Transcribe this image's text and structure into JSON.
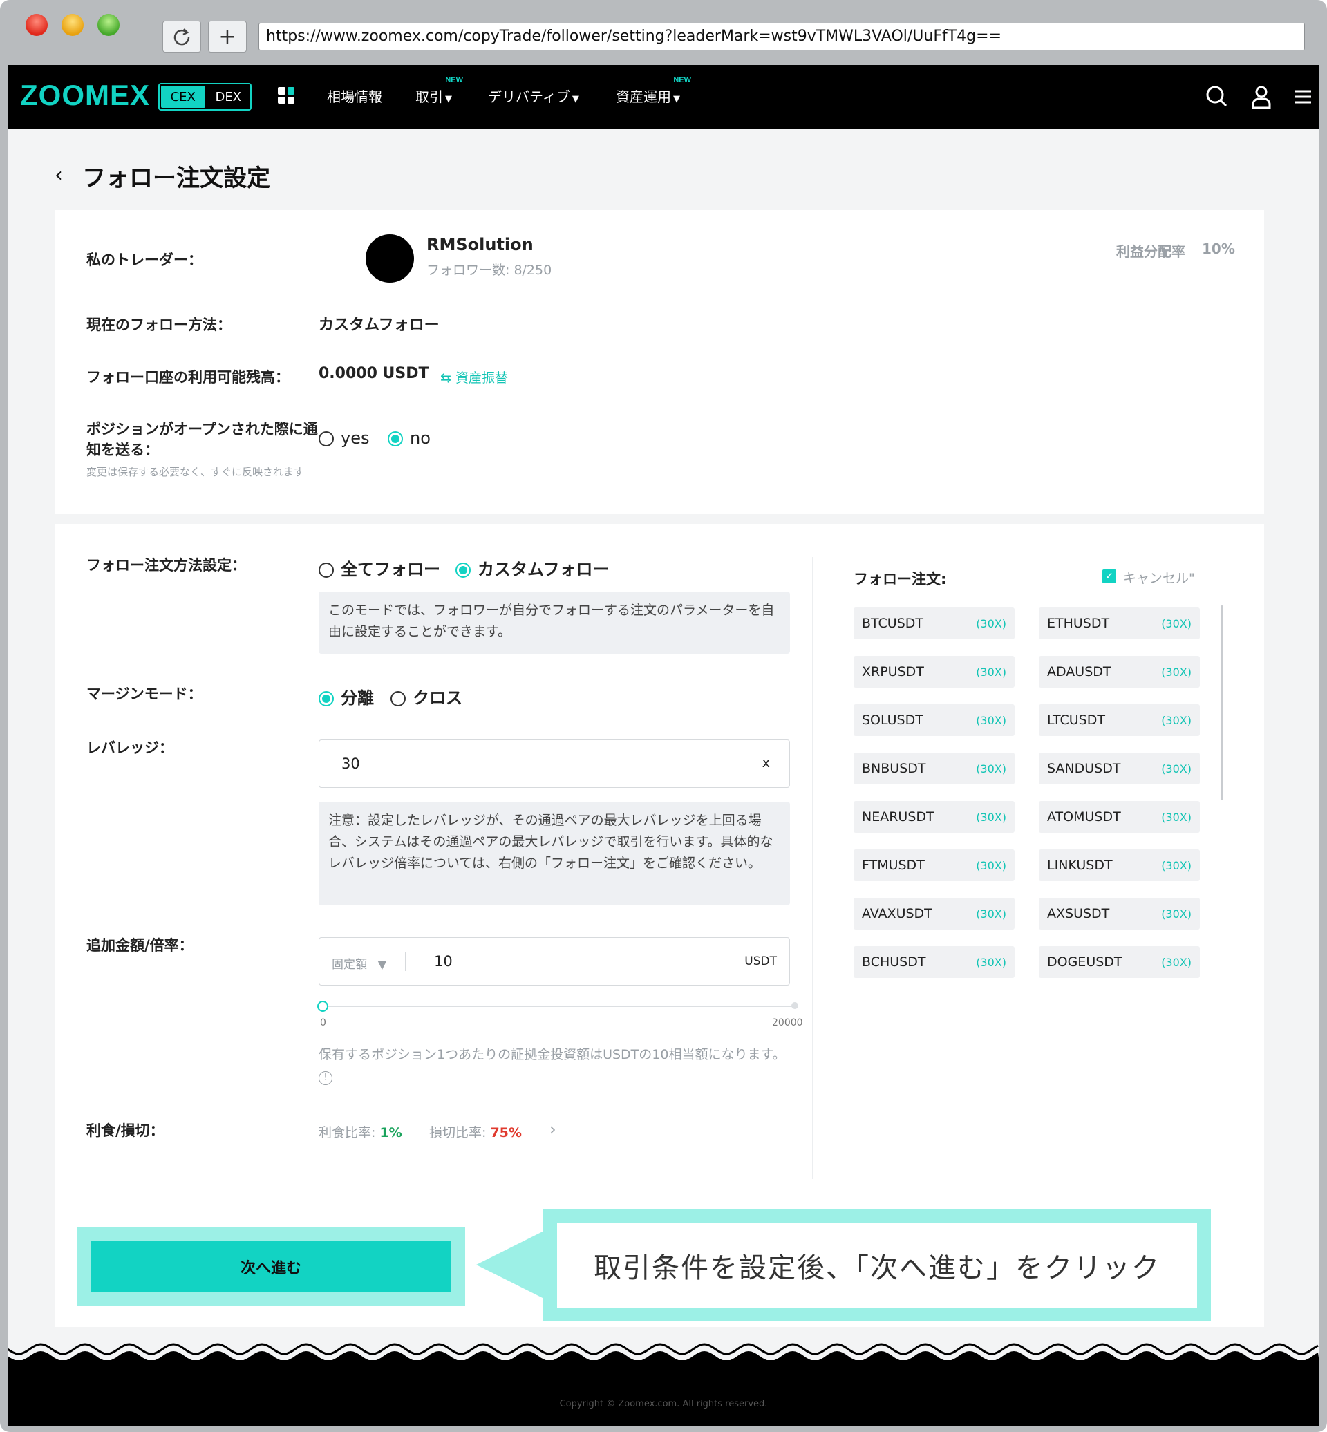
{
  "browser": {
    "url": "https://www.zoomex.com/copyTrade/follower/setting?leaderMark=wst9vTMWL3VAOl/UuFfT4g==",
    "reload_icon": "reload-icon",
    "new_tab_icon": "plus-icon"
  },
  "nav": {
    "logo": "ZOOMEX",
    "cex": "CEX",
    "dex": "DEX",
    "items": [
      {
        "label": "相場情報",
        "new": ""
      },
      {
        "label": "取引",
        "new": "NEW"
      },
      {
        "label": "デリバティブ",
        "new": ""
      },
      {
        "label": "資産運用",
        "new": "NEW"
      }
    ],
    "accent": "#12d3c3"
  },
  "page": {
    "title": "フォロー注文設定"
  },
  "trader": {
    "label": "私のトレーダー：",
    "name": "RMSolution",
    "followers": "フォロワー数: 8/250",
    "profit_share_label": "利益分配率",
    "profit_share": "10%"
  },
  "follow_method": {
    "label": "現在のフォロー方法：",
    "value": "カスタムフォロー"
  },
  "balance": {
    "label": "フォロー口座の利用可能残高：",
    "value": "0.0000 USDT",
    "transfer": "資産振替"
  },
  "notify": {
    "label": "ポジションがオープンされた際に通知を送る：",
    "hint": "変更は保存する必要なく、すぐに反映されます",
    "yes": "yes",
    "no": "no",
    "selected": "no"
  },
  "settings": {
    "method_label": "フォロー注文方法設定：",
    "opt_all": "全てフォロー",
    "opt_custom": "カスタムフォロー",
    "method_note": "このモードでは、フォロワーが自分でフォローする注文のパラメーターを自由に設定することができます。",
    "margin_label": "マージンモード：",
    "margin_isolated": "分離",
    "margin_cross": "クロス",
    "leverage_label": "レバレッジ：",
    "leverage_value": "30",
    "leverage_unit": "x",
    "leverage_note": "注意：設定したレバレッジが、その通過ペアの最大レバレッジを上回る場合、システムはその通過ペアの最大レバレッジで取引を行います。具体的なレバレッジ倍率については、右側の「フォロー注文」をご確認ください。",
    "amount_label": "追加金額/倍率：",
    "amount_type": "固定額",
    "amount_value": "10",
    "amount_unit": "USDT",
    "slider_min": "0",
    "slider_max": "20000",
    "slider_value": 10,
    "amount_note": "保有するポジション1つあたりの証拠金投資額はUSDTの10相当額になります。",
    "tpsl_label": "利食/損切：",
    "tp_label": "利食比率:",
    "tp_value": "1%",
    "sl_label": "損切比率:",
    "sl_value": "75%"
  },
  "orders": {
    "label": "フォロー注文:",
    "cancel": "キャンセル\"",
    "pairs": [
      {
        "sym": "BTCUSDT",
        "lev": "(30X)"
      },
      {
        "sym": "ETHUSDT",
        "lev": "(30X)"
      },
      {
        "sym": "XRPUSDT",
        "lev": "(30X)"
      },
      {
        "sym": "ADAUSDT",
        "lev": "(30X)"
      },
      {
        "sym": "SOLUSDT",
        "lev": "(30X)"
      },
      {
        "sym": "LTCUSDT",
        "lev": "(30X)"
      },
      {
        "sym": "BNBUSDT",
        "lev": "(30X)"
      },
      {
        "sym": "SANDUSDT",
        "lev": "(30X)"
      },
      {
        "sym": "NEARUSDT",
        "lev": "(30X)"
      },
      {
        "sym": "ATOMUSDT",
        "lev": "(30X)"
      },
      {
        "sym": "FTMUSDT",
        "lev": "(30X)"
      },
      {
        "sym": "LINKUSDT",
        "lev": "(30X)"
      },
      {
        "sym": "AVAXUSDT",
        "lev": "(30X)"
      },
      {
        "sym": "AXSUSDT",
        "lev": "(30X)"
      },
      {
        "sym": "BCHUSDT",
        "lev": "(30X)"
      },
      {
        "sym": "DOGEUSDT",
        "lev": "(30X)"
      }
    ]
  },
  "cta": {
    "next": "次へ進む",
    "callout": "取引条件を設定後、「次へ進む」をクリック"
  },
  "footer": {
    "copyright": "Copyright © Zoomex.com. All rights reserved."
  }
}
